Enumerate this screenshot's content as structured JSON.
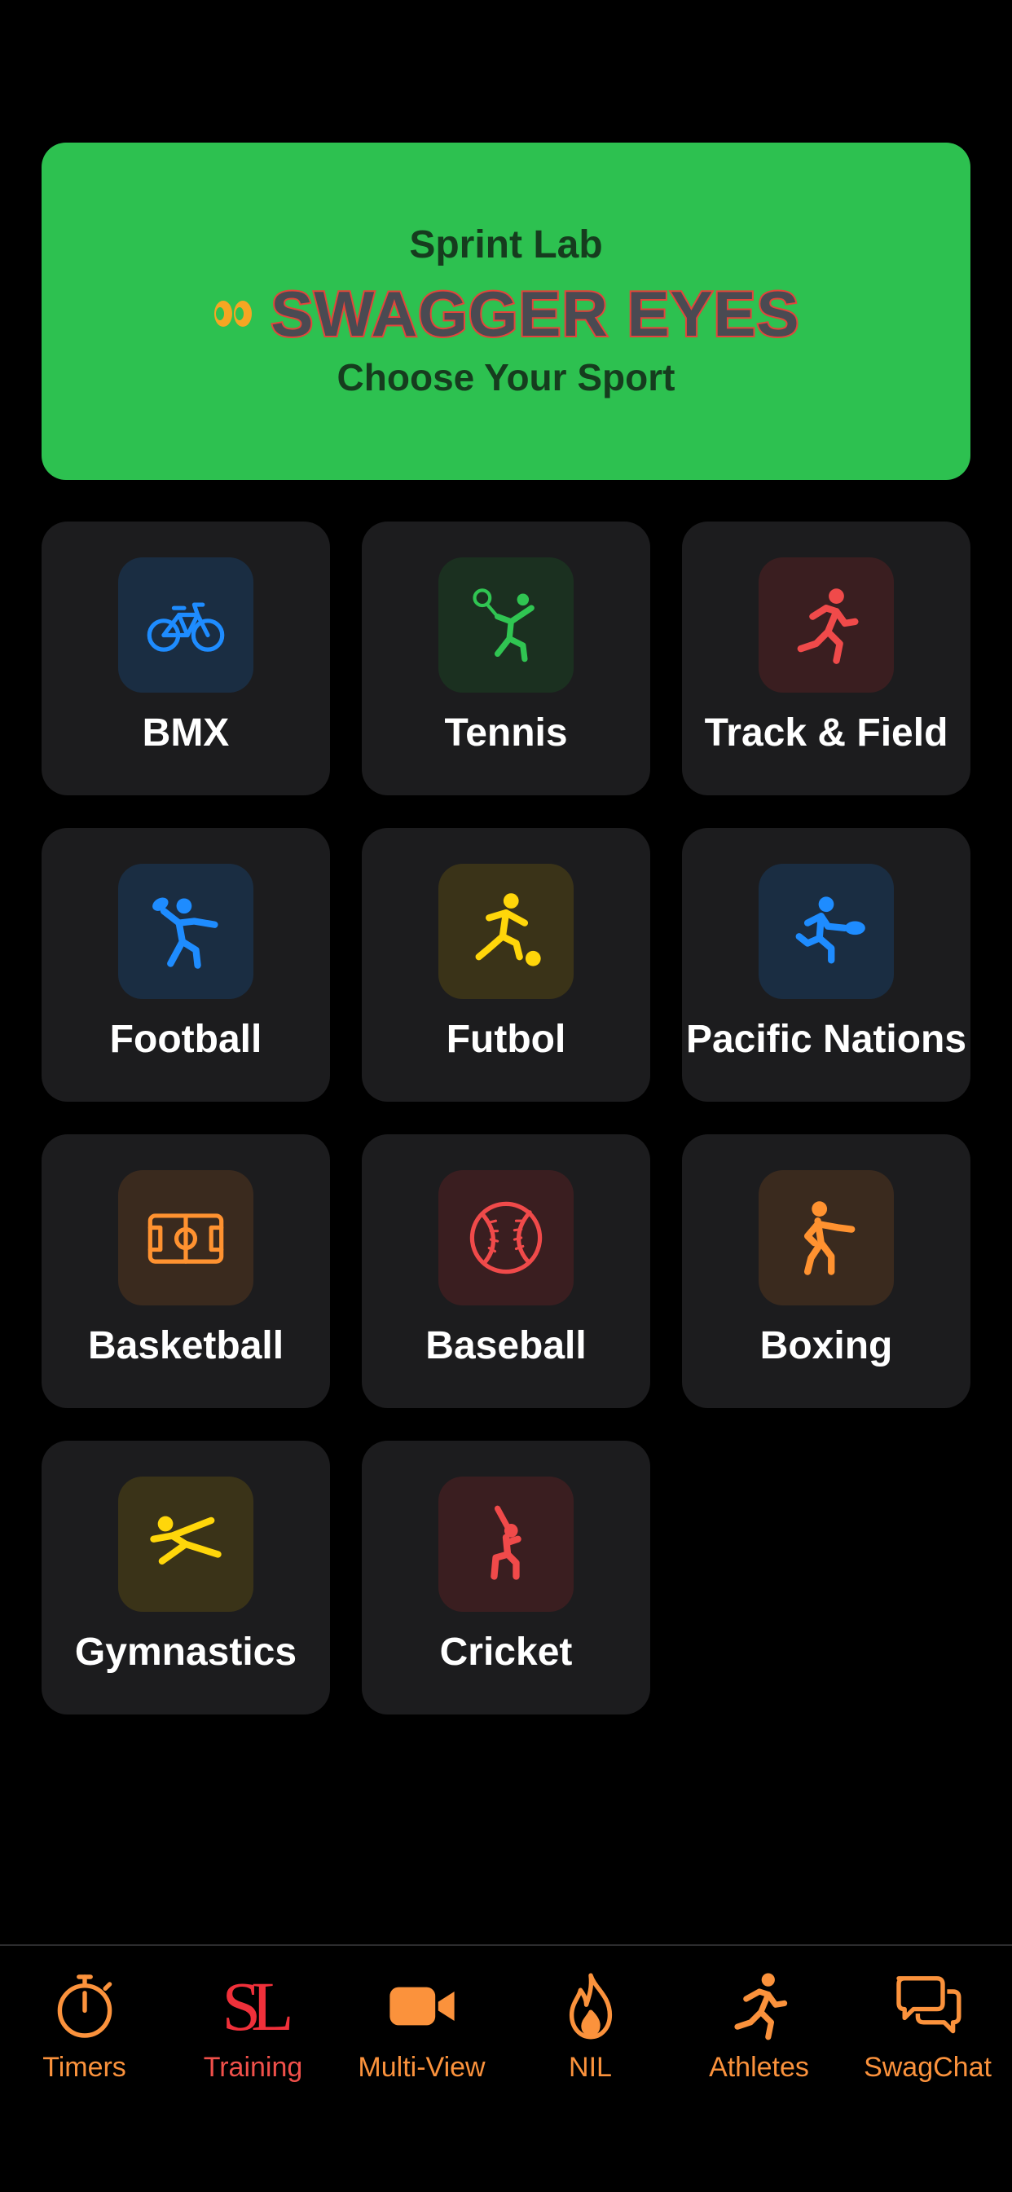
{
  "header": {
    "subtitle": "Sprint Lab",
    "brand": "SWAGGER EYES",
    "tagline": "Choose Your Sport",
    "bg_color": "#2dc150"
  },
  "sports": [
    {
      "label": "BMX",
      "icon": "bicycle-icon",
      "color": "#1e8cff",
      "tile": "#1a2d42"
    },
    {
      "label": "Tennis",
      "icon": "tennis-player-icon",
      "color": "#30c552",
      "tile": "#1b3020"
    },
    {
      "label": "Track & Field",
      "icon": "runner-icon",
      "color": "#f04a4a",
      "tile": "#3a1e20"
    },
    {
      "label": "Football",
      "icon": "football-thrower-icon",
      "color": "#1e8cff",
      "tile": "#1a2d42"
    },
    {
      "label": "Futbol",
      "icon": "soccer-player-icon",
      "color": "#ffd60a",
      "tile": "#3a3318"
    },
    {
      "label": "Pacific Nations",
      "icon": "rugby-player-icon",
      "color": "#1e8cff",
      "tile": "#1a2d42"
    },
    {
      "label": "Basketball",
      "icon": "court-icon",
      "color": "#ff9230",
      "tile": "#3a2a1e"
    },
    {
      "label": "Baseball",
      "icon": "baseball-icon",
      "color": "#f04a4a",
      "tile": "#3a1e20"
    },
    {
      "label": "Boxing",
      "icon": "boxer-icon",
      "color": "#ff9230",
      "tile": "#3a2a1e"
    },
    {
      "label": "Gymnastics",
      "icon": "gymnast-icon",
      "color": "#ffd60a",
      "tile": "#3a3318"
    },
    {
      "label": "Cricket",
      "icon": "cricket-batter-icon",
      "color": "#f04a4a",
      "tile": "#3a1e20"
    }
  ],
  "tabs": [
    {
      "label": "Timers",
      "icon": "stopwatch-icon",
      "active": false
    },
    {
      "label": "Training",
      "icon": "sl-logo-icon",
      "logo_text": "SL",
      "active": true
    },
    {
      "label": "Multi-View",
      "icon": "video-camera-icon",
      "active": false
    },
    {
      "label": "NIL",
      "icon": "flame-icon",
      "active": false
    },
    {
      "label": "Athletes",
      "icon": "runner-icon",
      "active": false
    },
    {
      "label": "SwagChat",
      "icon": "chat-bubbles-icon",
      "active": false
    }
  ],
  "colors": {
    "background": "#000000",
    "card": "#1c1c1e",
    "tab_accent": "#fb923c",
    "tab_active": "#f0504a"
  }
}
